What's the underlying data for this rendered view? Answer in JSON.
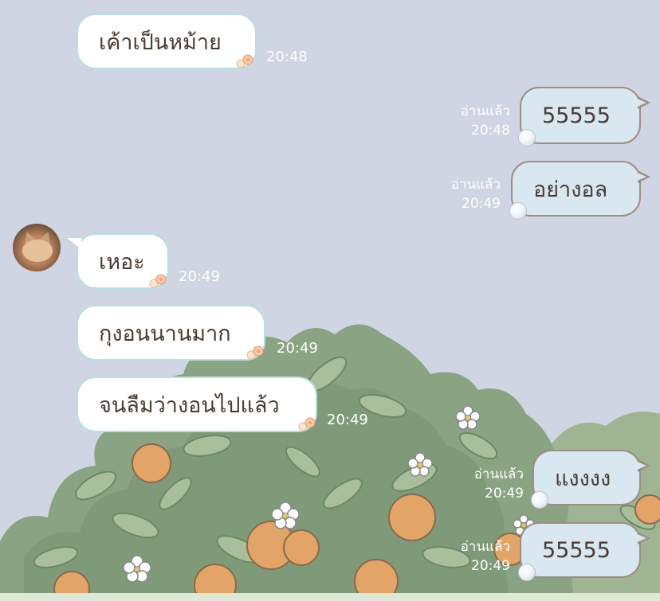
{
  "messages": [
    {
      "side": "in",
      "text": "เค้าเป็นหม้าย",
      "time": "20:48"
    },
    {
      "side": "out",
      "text": "55555",
      "read": "อ่านแล้ว",
      "time": "20:48"
    },
    {
      "side": "out",
      "text": "อย่างอล",
      "read": "อ่านแล้ว",
      "time": "20:49"
    },
    {
      "side": "in",
      "text": "เหอะ",
      "time": "20:49",
      "avatar": true
    },
    {
      "side": "in",
      "text": "กุงอนนานมาก",
      "time": "20:49"
    },
    {
      "side": "in",
      "text": "จนลืมว่างอนไปแล้ว",
      "time": "20:49"
    },
    {
      "side": "out",
      "text": "แงงงง",
      "read": "อ่านแล้ว",
      "time": "20:49"
    },
    {
      "side": "out",
      "text": "55555",
      "read": "อ่านแล้ว",
      "time": "20:49"
    }
  ],
  "colors": {
    "background": "#cfd5e2",
    "incoming_bubble": "#ffffff",
    "incoming_border": "#b9e0de",
    "outgoing_bubble": "#d8e7f0",
    "outgoing_border": "#9d8e84",
    "text": "#4a3a30",
    "meta_text": "#ffffff"
  },
  "icons": {
    "incoming_decoration": "flower-icon",
    "outgoing_decoration": "pearl-icon",
    "sender_avatar": "cat-avatar"
  }
}
